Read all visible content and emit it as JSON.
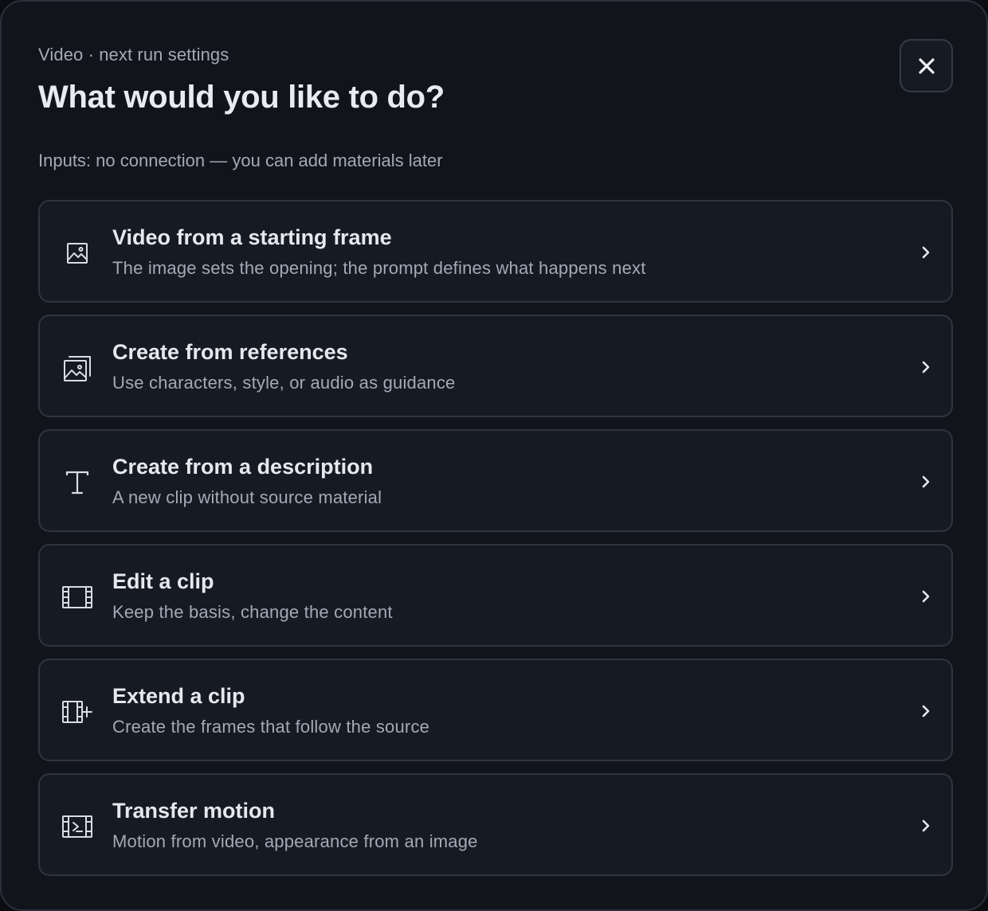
{
  "dialog": {
    "eyebrow": "Video · next run settings",
    "title": "What would you like to do?",
    "inputs_note": "Inputs: no connection — you can add materials later",
    "close_icon": "close-icon"
  },
  "options": [
    {
      "icon": "image-icon",
      "title": "Video from a starting frame",
      "description": "The image sets the opening; the prompt defines what happens next"
    },
    {
      "icon": "image-stack-icon",
      "title": "Create from references",
      "description": "Use characters, style, or audio as guidance"
    },
    {
      "icon": "text-icon",
      "title": "Create from a description",
      "description": "A new clip without source material"
    },
    {
      "icon": "film-icon",
      "title": "Edit a clip",
      "description": "Keep the basis, change the content"
    },
    {
      "icon": "film-plus-icon",
      "title": "Extend a clip",
      "description": "Create the frames that follow the source"
    },
    {
      "icon": "film-play-icon",
      "title": "Transfer motion",
      "description": "Motion from video, appearance from an image"
    }
  ]
}
